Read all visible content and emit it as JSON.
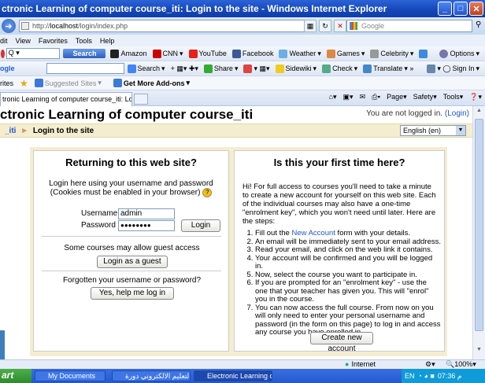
{
  "window": {
    "title": "ctronic Learning of computer course_iti: Login to the site - Windows Internet Explorer"
  },
  "address": {
    "url_prefix": "http://",
    "url_host": "localhost",
    "url_path": "/login/index.php",
    "search_placeholder": "Google"
  },
  "menu": [
    "dit",
    "View",
    "Favorites",
    "Tools",
    "Help"
  ],
  "toolbar1": {
    "search_label": "Search",
    "items": [
      "Amazon",
      "CNN",
      "YouTube",
      "Facebook",
      "Weather",
      "Games",
      "Celebrity",
      "Options"
    ]
  },
  "toolbar2": {
    "left": "ogle",
    "items": [
      "Search",
      "Share",
      "Sidewiki",
      "Check",
      "Translate",
      "Sign In"
    ]
  },
  "favbar": {
    "label": "rites",
    "suggested": "Suggested Sites",
    "addons": "Get More Add-ons"
  },
  "tab": {
    "title": "tronic Learning of computer course_iti: Login to th...",
    "commands": [
      "Page",
      "Safety",
      "Tools"
    ]
  },
  "page": {
    "heading": "ctronic Learning of computer course_iti",
    "login_status": "You are not logged in.",
    "login_link": "(Login)",
    "crumb_home": "_iti",
    "crumb_sep": "►",
    "crumb_current": "Login to the site",
    "language": "English (en)"
  },
  "login_box": {
    "title": "Returning to this web site?",
    "instructions": "Login here using your username and password",
    "cookies": "(Cookies must be enabled in your browser)",
    "username_label": "Username",
    "username_value": "admin",
    "password_label": "Password",
    "password_value": "●●●●●●●●",
    "login_button": "Login",
    "guest_text": "Some courses may allow guest access",
    "guest_button": "Login as a guest",
    "forgot_text": "Forgotten your username or password?",
    "forgot_button": "Yes, help me log in"
  },
  "signup_box": {
    "title": "Is this your first time here?",
    "intro": "Hi! For full access to courses you'll need to take a minute to create a new account for yourself on this web site. Each of the individual courses may also have a one-time \"enrolment key\", which you won't need until later. Here are the steps:",
    "steps": [
      {
        "pre": "Fill out the ",
        "link": "New Account",
        "post": " form with your details."
      },
      {
        "pre": "An email will be immediately sent to your email address.",
        "link": "",
        "post": ""
      },
      {
        "pre": "Read your email, and click on the web link it contains.",
        "link": "",
        "post": ""
      },
      {
        "pre": "Your account will be confirmed and you will be logged in.",
        "link": "",
        "post": ""
      },
      {
        "pre": "Now, select the course you want to participate in.",
        "link": "",
        "post": ""
      },
      {
        "pre": "If you are prompted for an \"enrolment key\" - use the one that your teacher has given you. This will \"enrol\" you in the course.",
        "link": "",
        "post": ""
      },
      {
        "pre": "You can now access the full course. From now on you will only need to enter your personal username and password (in the form on this page) to log in and access any course you have enrolled in.",
        "link": "",
        "post": ""
      }
    ],
    "button": "Create new account"
  },
  "status": {
    "zone": "Internet",
    "zoom": "100%"
  },
  "taskbar": {
    "start": "art",
    "tasks": [
      "My Documents",
      "التعليم الالكتروني دورة...",
      "Electronic Learning of..."
    ],
    "lang": "EN",
    "time": "07:36 م"
  },
  "colors": {
    "titlebar": "#1546b8",
    "crumb_bar": "#f4edd0",
    "link": "#2255cc"
  }
}
